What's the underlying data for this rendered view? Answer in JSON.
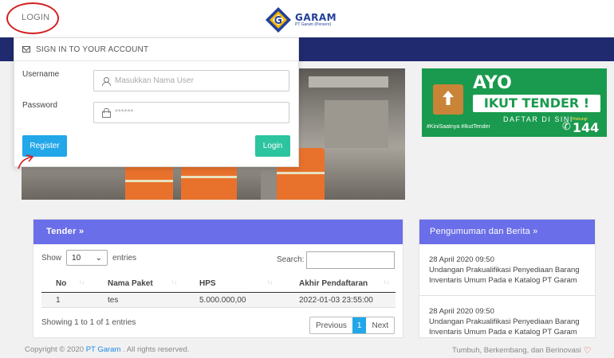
{
  "header": {
    "login_link": "LOGIN",
    "logo_name": "GARAM",
    "logo_sub": "PT Garam (Persero)"
  },
  "login_panel": {
    "title": "SIGN IN TO YOUR ACCOUNT",
    "username_label": "Username",
    "username_placeholder": "Masukkan Nama User",
    "password_label": "Password",
    "password_placeholder": "******",
    "register_button": "Register",
    "login_button": "Login"
  },
  "ad": {
    "line1": "AYO",
    "line2": "IKUT TENDER !",
    "line3": "DAFTAR DI SINI",
    "hashtags": "#KiniSaatnya #IkutTender",
    "phone_label": "Hubungi",
    "phone_number": "144"
  },
  "tender": {
    "title": "Tender »",
    "show_label": "Show",
    "entries_value": "10",
    "entries_label": "entries",
    "search_label": "Search:",
    "columns": [
      "No",
      "Nama Paket",
      "HPS",
      "Akhir Pendaftaran"
    ],
    "rows": [
      {
        "no": "1",
        "nama": "tes",
        "hps": "5.000.000,00",
        "akhir": "2022-01-03 23:55:00"
      }
    ],
    "info": "Showing 1 to 1 of 1 entries",
    "pager": {
      "prev": "Previous",
      "current": "1",
      "next": "Next"
    }
  },
  "news": {
    "title": "Pengumuman dan Berita »",
    "items": [
      {
        "date": "28 April 2020 09:50",
        "text": "Undangan Prakualifikasi Penyediaan Barang Inventaris Umum Pada e Katalog PT Garam"
      },
      {
        "date": "28 April 2020 09:50",
        "text": "Undangan Prakualifikasi Penyediaan Barang Inventaris Umum Pada e Katalog PT Garam"
      }
    ]
  },
  "footer": {
    "copyright_prefix": "Copyright © 2020",
    "brand": "PT Garam",
    "copyright_suffix": ". All rights reserved.",
    "tagline": "Tumbuh, Berkembang, dan Berinovasi"
  },
  "colors": {
    "nav_band": "#1f2b6e",
    "card_header": "#6a6ee8",
    "register_button": "#22a7e8",
    "login_button": "#2dc4a0",
    "annotation_red": "#d42020"
  }
}
